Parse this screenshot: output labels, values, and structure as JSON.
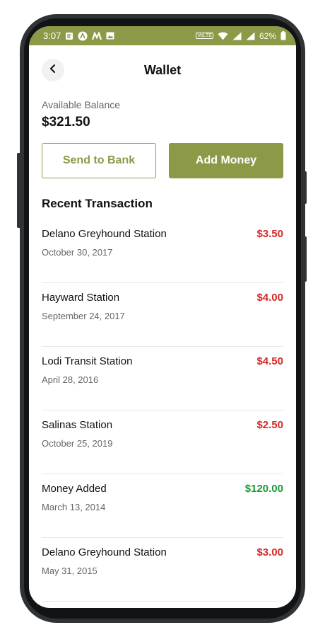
{
  "status_bar": {
    "time": "3:07",
    "volte": "VoLTE",
    "battery": "62%"
  },
  "header": {
    "title": "Wallet",
    "back_icon": "chevron-left-icon"
  },
  "balance": {
    "label": "Available Balance",
    "value": "$321.50"
  },
  "actions": {
    "send_label": "Send to Bank",
    "add_label": "Add Money"
  },
  "colors": {
    "accent": "#8c9a47",
    "debit": "#d42a2a",
    "credit": "#1a9a3a"
  },
  "transactions": {
    "title": "Recent Transaction",
    "items": [
      {
        "name": "Delano Greyhound Station",
        "date": "October 30, 2017",
        "amount": "$3.50",
        "type": "debit"
      },
      {
        "name": "Hayward Station",
        "date": "September 24, 2017",
        "amount": "$4.00",
        "type": "debit"
      },
      {
        "name": "Lodi Transit Station",
        "date": "April 28, 2016",
        "amount": "$4.50",
        "type": "debit"
      },
      {
        "name": "Salinas Station",
        "date": "October 25, 2019",
        "amount": "$2.50",
        "type": "debit"
      },
      {
        "name": "Money Added",
        "date": "March 13, 2014",
        "amount": "$120.00",
        "type": "credit"
      },
      {
        "name": "Delano Greyhound Station",
        "date": "May 31, 2015",
        "amount": "$3.00",
        "type": "debit"
      }
    ]
  }
}
